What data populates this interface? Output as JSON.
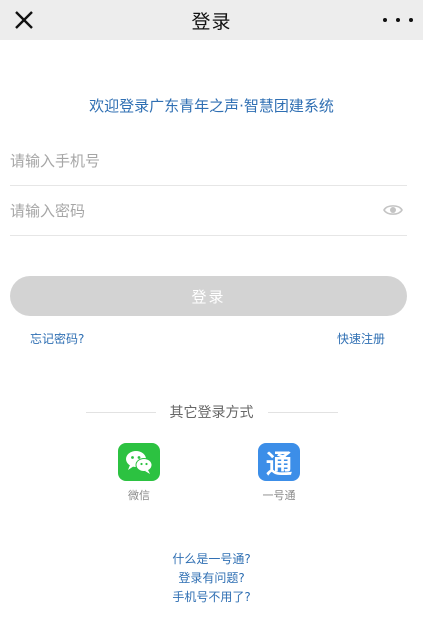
{
  "header": {
    "title": "登录"
  },
  "welcome_text": "欢迎登录广东青年之声·智慧团建系统",
  "form": {
    "phone_placeholder": "请输入手机号",
    "password_placeholder": "请输入密码",
    "login_label": "登录"
  },
  "links": {
    "forgot_password": "忘记密码?",
    "quick_register": "快速注册"
  },
  "other_login": {
    "label": "其它登录方式",
    "apps": [
      {
        "label": "微信",
        "icon": "wechat-icon"
      },
      {
        "label": "一号通",
        "icon_text": "通",
        "icon": "yihaotong-icon"
      }
    ]
  },
  "help": [
    "什么是一号通?",
    "登录有问题?",
    "手机号不用了?"
  ],
  "colors": {
    "accent": "#2f6fb3",
    "login_button": "#d3d3d3",
    "wechat": "#2cc241",
    "yihaotong": "#3c8ee8"
  }
}
